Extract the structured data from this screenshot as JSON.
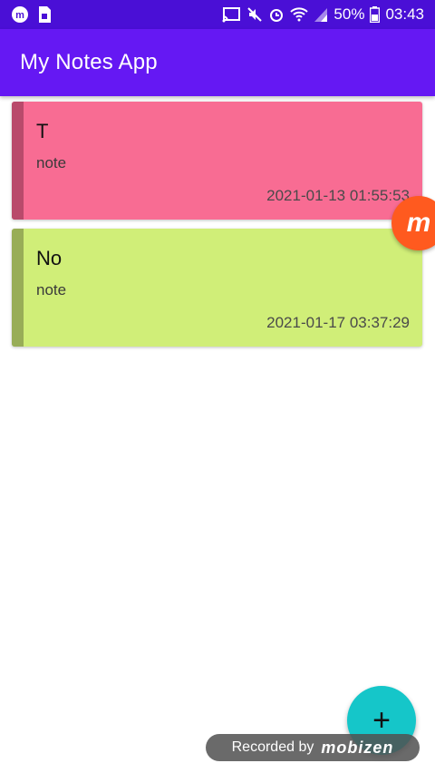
{
  "status_bar": {
    "battery_percent": "50%",
    "time": "03:43",
    "icons_left": [
      "mobizen-icon",
      "sim-card-icon"
    ],
    "icons_right": [
      "cast-icon",
      "mute-icon",
      "alarm-icon",
      "wifi-icon",
      "signal-icon",
      "battery-icon"
    ]
  },
  "app_bar": {
    "title": "My Notes App"
  },
  "notes": [
    {
      "title": "T",
      "body": "note",
      "date": "2021-01-13 01:55:53",
      "color": "#f86c93",
      "stripe_color": "#b94a6b"
    },
    {
      "title": "No",
      "body": "note",
      "date": "2021-01-17 03:37:29",
      "color": "#d0ee78",
      "stripe_color": "#98ad57"
    }
  ],
  "fab": {
    "icon": "plus-icon",
    "label": "+"
  },
  "overlay": {
    "mobizen_float_label": "m",
    "recorded_by": "Recorded by",
    "brand": "mobizen"
  },
  "colors": {
    "status_bar": "#4a0fd6",
    "app_bar": "#6518f3",
    "fab": "#15c6c9"
  }
}
